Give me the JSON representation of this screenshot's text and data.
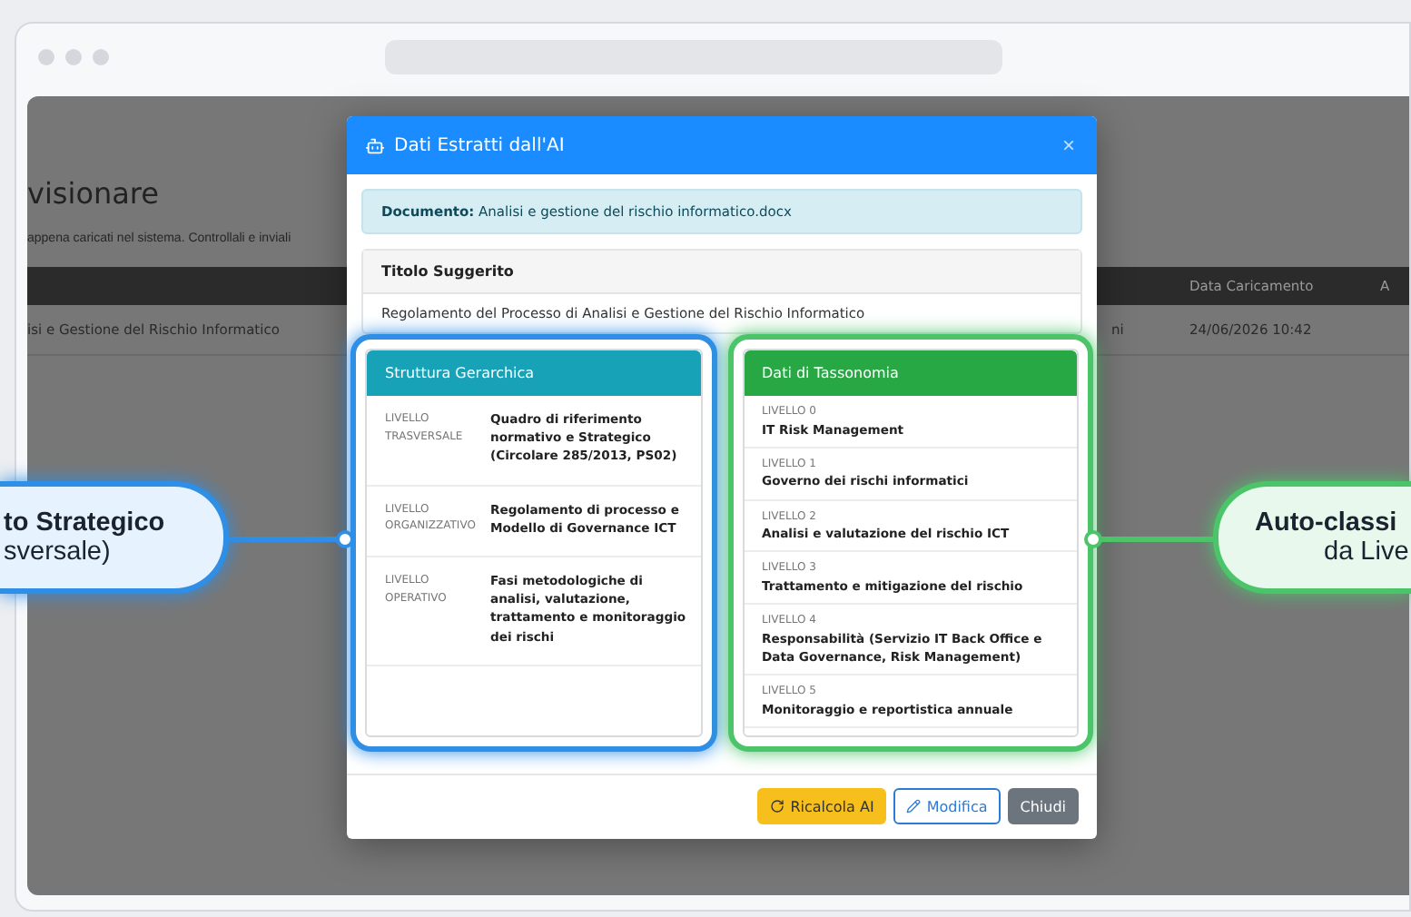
{
  "page": {
    "heading": "visionare",
    "subtitle": "appena caricati nel sistema. Controllali e inviali",
    "table": {
      "column_3": "Data Caricamento",
      "column_4": "A",
      "rows": [
        {
          "column_1": "isi e Gestione del Rischio Informatico",
          "column_2": "ni",
          "column_3": "24/06/2026 10:42"
        }
      ]
    }
  },
  "modal": {
    "title": "Dati Estratti dall'AI",
    "close": "×",
    "document": {
      "label": "Documento:",
      "value": "Analisi e gestione del rischio informatico.docx"
    },
    "suggested_title": {
      "heading": "Titolo Suggerito",
      "value": "Regolamento del Processo di Analisi e Gestione del Rischio Informatico"
    },
    "structure": {
      "heading": "Struttura Gerarchica",
      "items": [
        {
          "level": "LIVELLO TRASVERSALE",
          "text": "Quadro di riferimento normativo e Strategico (Circolare 285/2013, PS02)"
        },
        {
          "level": "LIVELLO ORGANIZZATIVO",
          "text": "Regolamento di processo e Modello di Governance ICT"
        },
        {
          "level": "LIVELLO OPERATIVO",
          "text": "Fasi metodologiche di analisi, valutazione, trattamento e monitoraggio dei rischi"
        }
      ]
    },
    "taxonomy": {
      "heading": "Dati di Tassonomia",
      "items": [
        {
          "level": "LIVELLO 0",
          "text": "IT Risk Management"
        },
        {
          "level": "LIVELLO 1",
          "text": "Governo dei rischi informatici"
        },
        {
          "level": "LIVELLO 2",
          "text": "Analisi e valutazione del rischio ICT"
        },
        {
          "level": "LIVELLO 3",
          "text": "Trattamento e mitigazione del rischio"
        },
        {
          "level": "LIVELLO 4",
          "text": "Responsabilità (Servizio IT Back Office e Data Governance, Risk Management)"
        },
        {
          "level": "LIVELLO 5",
          "text": "Monitoraggio e reportistica annuale"
        }
      ]
    },
    "buttons": [
      {
        "label": "Ricalcola AI",
        "kind": "recalc"
      },
      {
        "label": "Modifica",
        "kind": "edit"
      },
      {
        "label": "Chiudi",
        "kind": "close"
      }
    ]
  },
  "callouts": [
    {
      "title": "to Strategico",
      "subtitle": "sversale)",
      "color": "#2f8ee5"
    },
    {
      "title": "Auto-classi",
      "subtitle": "da Live",
      "color": "#4cc46a"
    }
  ]
}
